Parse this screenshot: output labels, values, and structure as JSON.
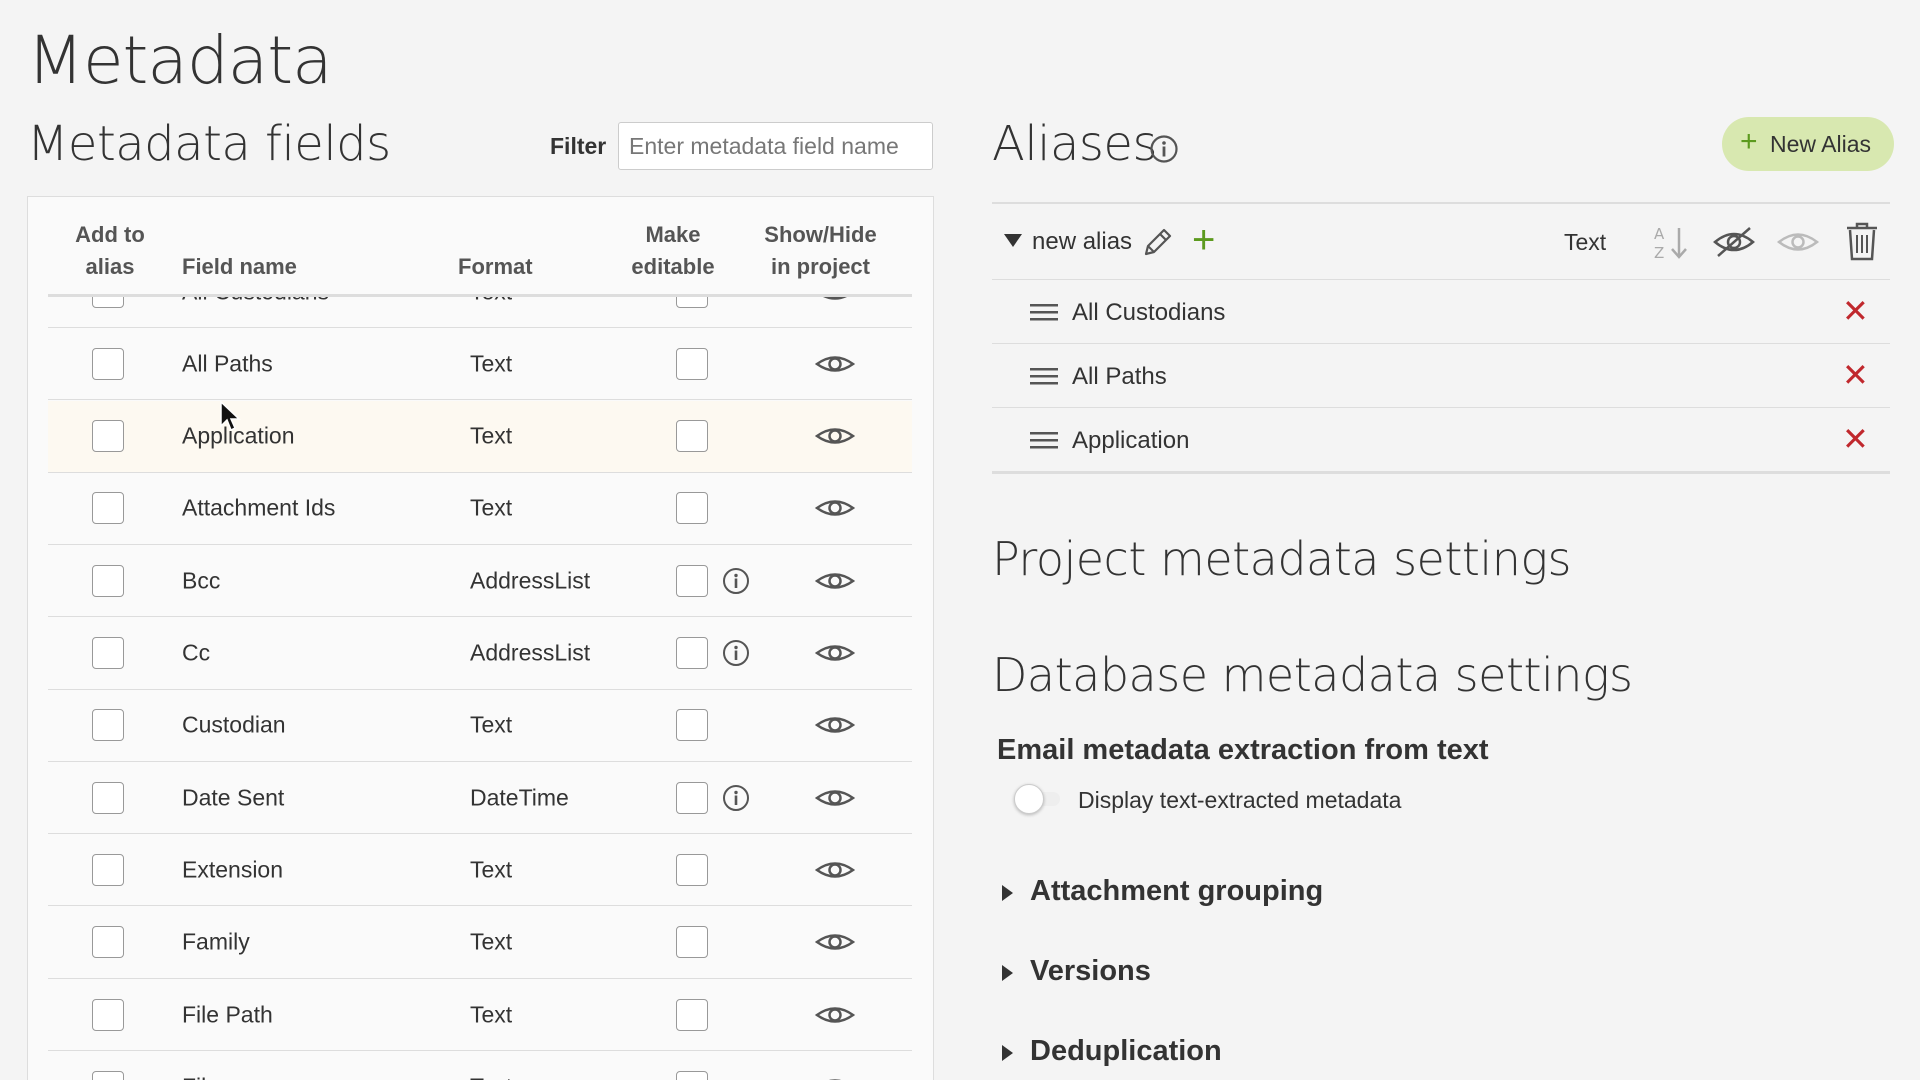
{
  "page": {
    "title": "Metadata"
  },
  "metadata_fields": {
    "title": "Metadata fields",
    "filter_label": "Filter",
    "filter_placeholder": "Enter metadata field name",
    "columns": {
      "add_to_alias": "Add to\nalias",
      "field_name": "Field name",
      "format": "Format",
      "make_editable": "Make\neditable",
      "show_hide": "Show/Hide\nin project"
    },
    "rows": [
      {
        "name": "All Custodians",
        "format": "Text",
        "info": false
      },
      {
        "name": "All Paths",
        "format": "Text",
        "info": false
      },
      {
        "name": "Application",
        "format": "Text",
        "info": false
      },
      {
        "name": "Attachment Ids",
        "format": "Text",
        "info": false
      },
      {
        "name": "Bcc",
        "format": "AddressList",
        "info": true
      },
      {
        "name": "Cc",
        "format": "AddressList",
        "info": true
      },
      {
        "name": "Custodian",
        "format": "Text",
        "info": false
      },
      {
        "name": "Date Sent",
        "format": "DateTime",
        "info": true
      },
      {
        "name": "Extension",
        "format": "Text",
        "info": false
      },
      {
        "name": "Family",
        "format": "Text",
        "info": false
      },
      {
        "name": "File Path",
        "format": "Text",
        "info": false
      },
      {
        "name": "File...",
        "format": "Text",
        "info": false
      }
    ]
  },
  "aliases": {
    "title": "Aliases",
    "new_alias_label": "New Alias",
    "group": {
      "name": "new alias",
      "format": "Text",
      "items": [
        "All Custodians",
        "All Paths",
        "Application"
      ]
    }
  },
  "project_settings": {
    "title": "Project metadata settings"
  },
  "database_settings": {
    "title": "Database metadata settings",
    "email_title": "Email metadata extraction from text",
    "toggle_label": "Display text-extracted metadata",
    "toggle_on": false,
    "sections": [
      "Attachment grouping",
      "Versions",
      "Deduplication"
    ]
  },
  "colors": {
    "accent_green": "#5c9a1e",
    "button_green_bg": "#d8e8b0",
    "remove_red": "#c0282d"
  }
}
